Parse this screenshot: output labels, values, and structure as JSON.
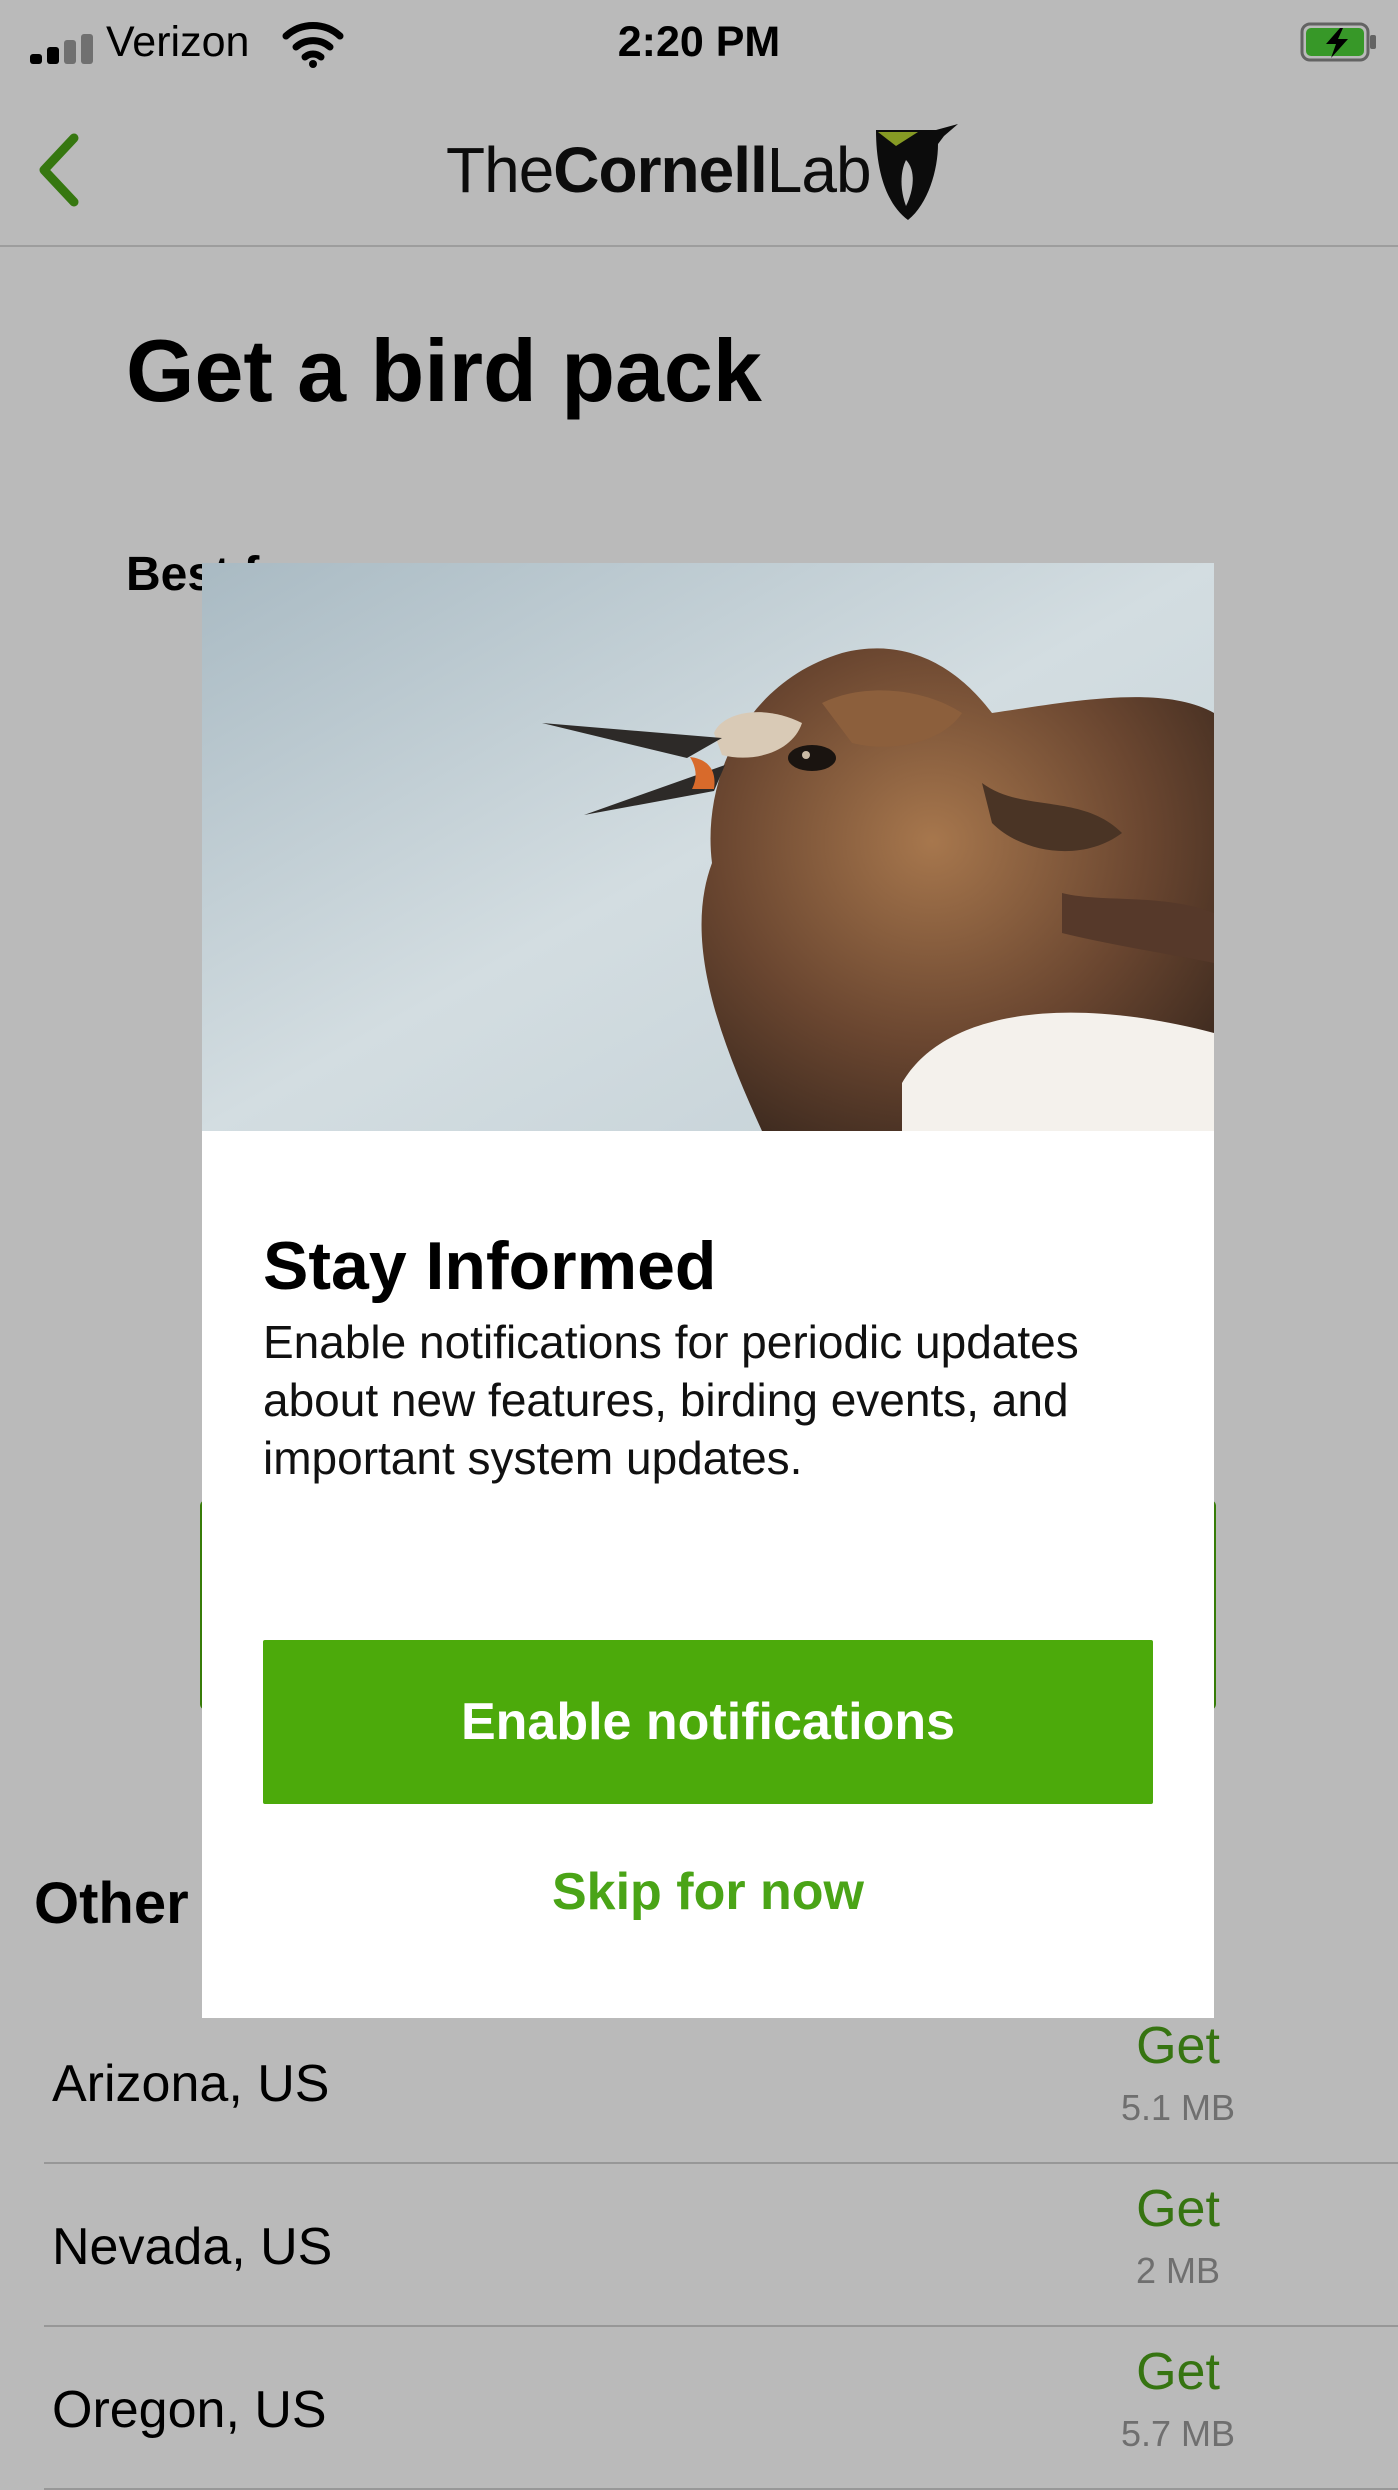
{
  "status_bar": {
    "carrier": "Verizon",
    "time": "2:20 PM",
    "icons": [
      "signal-icon",
      "wifi-icon",
      "battery-charging-icon"
    ]
  },
  "nav": {
    "back_icon": "chevron-left-icon",
    "logo_prefix": "The",
    "logo_bold": "Cornell",
    "logo_suffix": "Lab"
  },
  "page": {
    "title": "Get a bird pack",
    "best_prefix": "Best for",
    "other_title": "Other packs"
  },
  "packs": [
    {
      "name": "Arizona, US",
      "action": "Get",
      "size": "5.1 MB"
    },
    {
      "name": "Nevada, US",
      "action": "Get",
      "size": "2 MB"
    },
    {
      "name": "Oregon, US",
      "action": "Get",
      "size": "5.7 MB"
    }
  ],
  "modal": {
    "image": "bird-photo",
    "title": "Stay Informed",
    "body": "Enable notifications for periodic updates about new features, birding events, and important system updates.",
    "primary_label": "Enable notifications",
    "secondary_label": "Skip for now"
  },
  "colors": {
    "accent_green": "#4caa0b",
    "link_green": "#4aa417",
    "overlay": "rgba(0,0,0,0.27)"
  }
}
